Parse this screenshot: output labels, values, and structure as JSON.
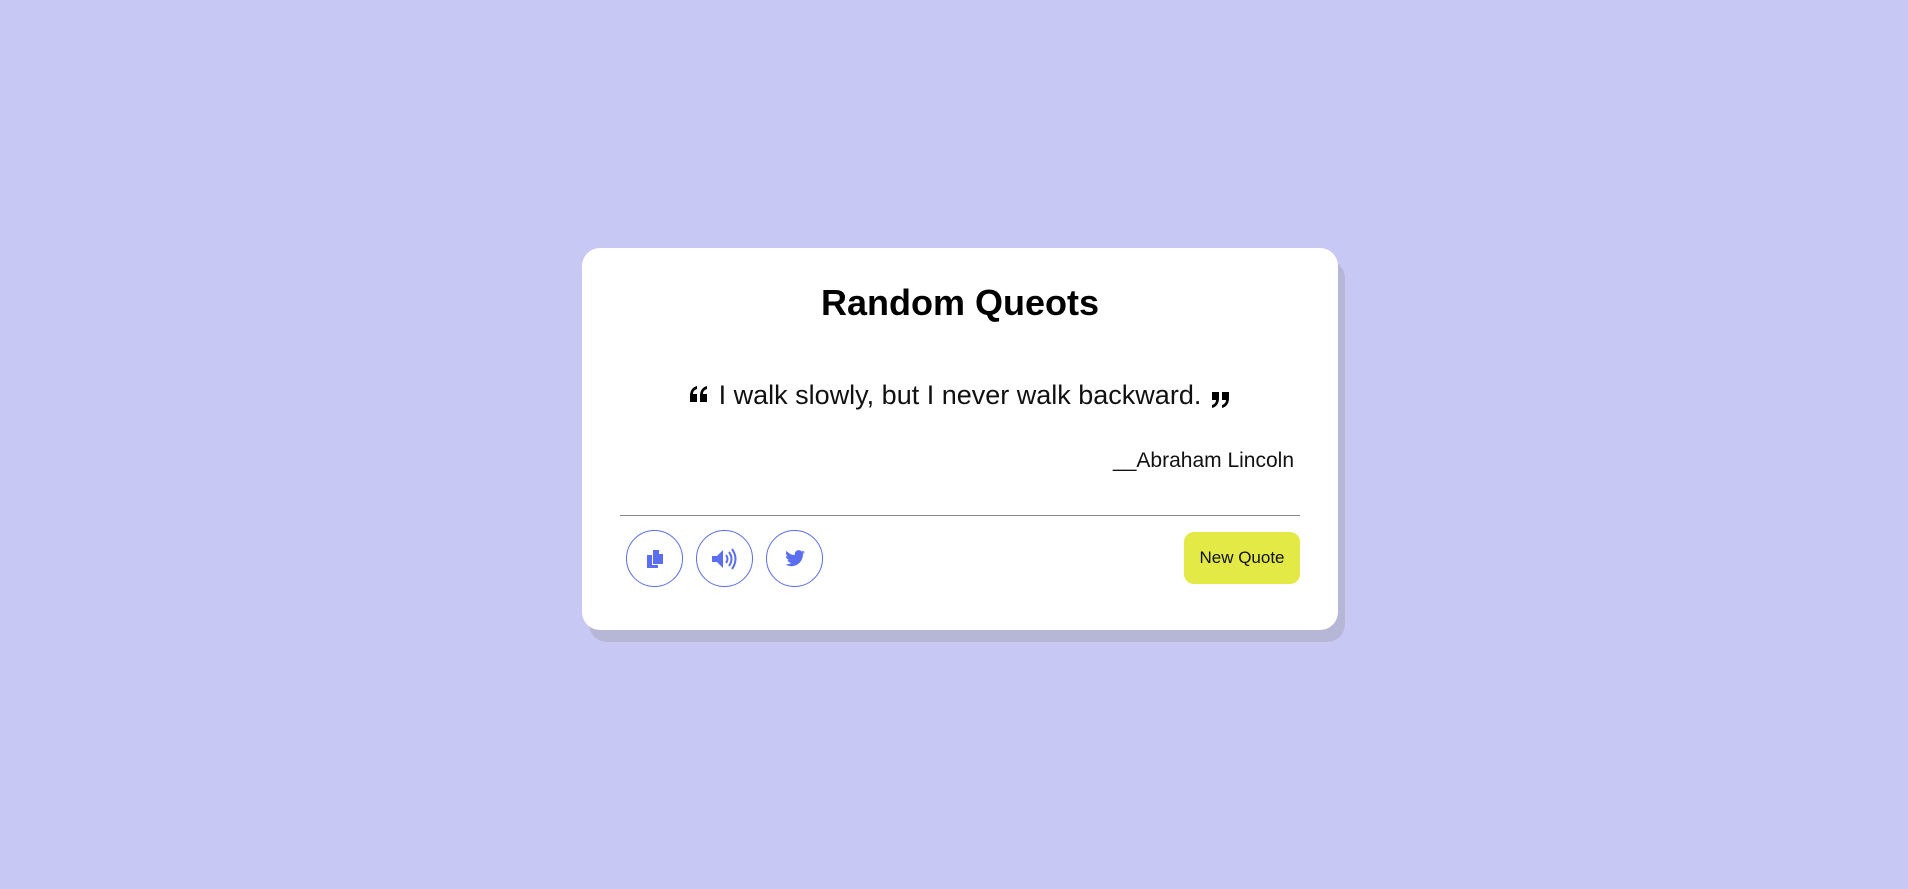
{
  "app": {
    "title": "Random Queots"
  },
  "quote": {
    "text": "I walk slowly, but I never walk backward.",
    "author": "__Abraham Lincoln",
    "open_mark_icon": "quote-left-icon",
    "close_mark_icon": "quote-right-icon"
  },
  "actions": {
    "copy_icon": "copy-icon",
    "speak_icon": "volume-icon",
    "tweet_icon": "twitter-icon",
    "new_quote_label": "New Quote"
  },
  "colors": {
    "background": "#c8c8f5",
    "card": "#ffffff",
    "accent": "#5b6ef0",
    "button": "#e3ea45"
  }
}
